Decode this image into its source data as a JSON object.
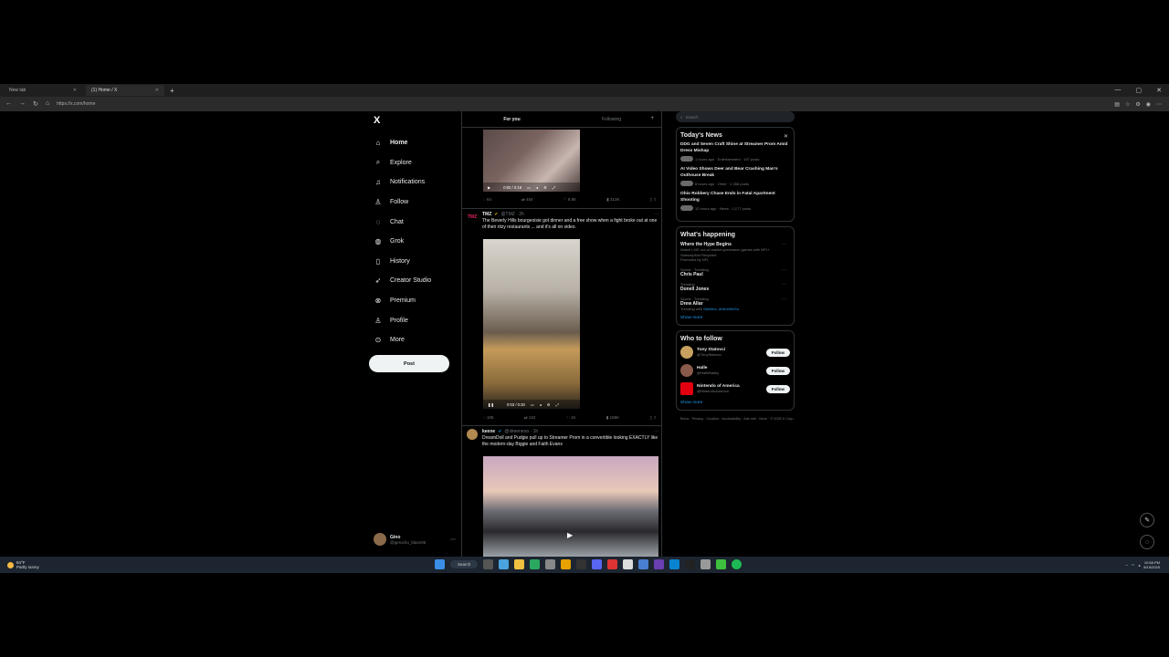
{
  "browser": {
    "tabs": [
      {
        "label": "New tab",
        "active": false
      },
      {
        "label": "(1) Home / X",
        "active": true
      }
    ],
    "url": "https://x.com/home"
  },
  "left_nav": {
    "logo": "X",
    "items": [
      {
        "label": "Home",
        "icon": "home-icon",
        "glyph": "⌂"
      },
      {
        "label": "Explore",
        "icon": "search-icon",
        "glyph": "⌕"
      },
      {
        "label": "Notifications",
        "icon": "bell-icon",
        "glyph": "♫"
      },
      {
        "label": "Follow",
        "icon": "person-icon",
        "glyph": "♙"
      },
      {
        "label": "Chat",
        "icon": "chat-icon",
        "glyph": "◌"
      },
      {
        "label": "Grok",
        "icon": "grok-icon",
        "glyph": "◍"
      },
      {
        "label": "History",
        "icon": "bookmark-icon",
        "glyph": "▯"
      },
      {
        "label": "Creator Studio",
        "icon": "rocket-icon",
        "glyph": "➶"
      },
      {
        "label": "Premium",
        "icon": "x-circle-icon",
        "glyph": "⊗"
      },
      {
        "label": "Profile",
        "icon": "profile-icon",
        "glyph": "♙"
      },
      {
        "label": "More",
        "icon": "more-circle-icon",
        "glyph": "⊙"
      }
    ],
    "post_label": "Post",
    "profile": {
      "name": "Gino",
      "handle": "@gerucho_blaze05"
    }
  },
  "feed": {
    "tabs": [
      "For you",
      "Following"
    ],
    "video1": {
      "time": "0:02 / 0:16"
    },
    "actions1": [
      "64",
      "454",
      "8.8K",
      "313K"
    ],
    "tweet2": {
      "name": "TMZ",
      "handle": "@TMZ · 2h",
      "text": "The Beverly Hills bourgeoisie got dinner and a free show when a fight broke out at one of their ritzy restaurants ... and it's all on video.",
      "video_time": "0:03 / 0:30",
      "actions": [
        "106",
        "122",
        "1K",
        "196K"
      ]
    },
    "tweet3": {
      "name": "keene",
      "handle": "@xkeeneoo · 1h",
      "text": "DreamDoll and Pudgie pull up to Streamer Prom in a convertible looking EXACTLY like the modern-day Biggie and Faith Evans"
    }
  },
  "right_col": {
    "search_placeholder": "Search",
    "news_title": "Today's News",
    "news": [
      {
        "title": "DDG and Seven Craft Shine at Streamer Prom Amid Dress Mishap",
        "meta": "1 hours ago · Entertainment · 197 posts"
      },
      {
        "title": "AI Video Shows Deer and Bear Crashing Man's Outhouse Break",
        "meta": "8 hours ago · Other · 2,358 posts"
      },
      {
        "title": "Ohio Robbery Chase Ends in Fatal Apartment Shooting",
        "meta": "12 hours ago · News · 1,177 posts"
      }
    ],
    "happening_title": "What's happening",
    "trends": [
      {
        "cat": "",
        "name": "Where the Hype Begins",
        "desc": "Watch LIVE out-of-market preseason games with NFL+ Subscription Required",
        "extra": "Promoted by NFL"
      },
      {
        "cat": "Sports · Trending",
        "name": "Chris Paul",
        "desc": "",
        "extra": ""
      },
      {
        "cat": "Trending",
        "name": "Donell Jones",
        "desc": "",
        "extra": ""
      },
      {
        "cat": "Sports · Trending",
        "name": "Drew Allar",
        "desc": "Trending with",
        "extra": "Steelers, #HereWeGo"
      }
    ],
    "show_more": "Show more",
    "wtf_title": "Who to follow",
    "who_to_follow": [
      {
        "name": "Tony Statovci",
        "handle": "@TonyStatovci",
        "color": "#c8a060"
      },
      {
        "name": "Halle",
        "handle": "@HalleBailey",
        "color": "#8a5a4a"
      },
      {
        "name": "Nintendo of America",
        "handle": "@NintendoAmerica",
        "color": "#e4000f"
      }
    ],
    "follow_label": "Follow",
    "footer": "Terms · Privacy · Cookies · Accessibility · Ads info · More · © 2025 X Corp."
  },
  "taskbar": {
    "temp": "84°F",
    "weather": "Partly sunny",
    "search": "Search",
    "time": "10:58 PM",
    "date": "8/15/2025"
  },
  "colors": {
    "accent": "#1d9bf0",
    "bg": "#000000",
    "border": "#2f3336"
  }
}
